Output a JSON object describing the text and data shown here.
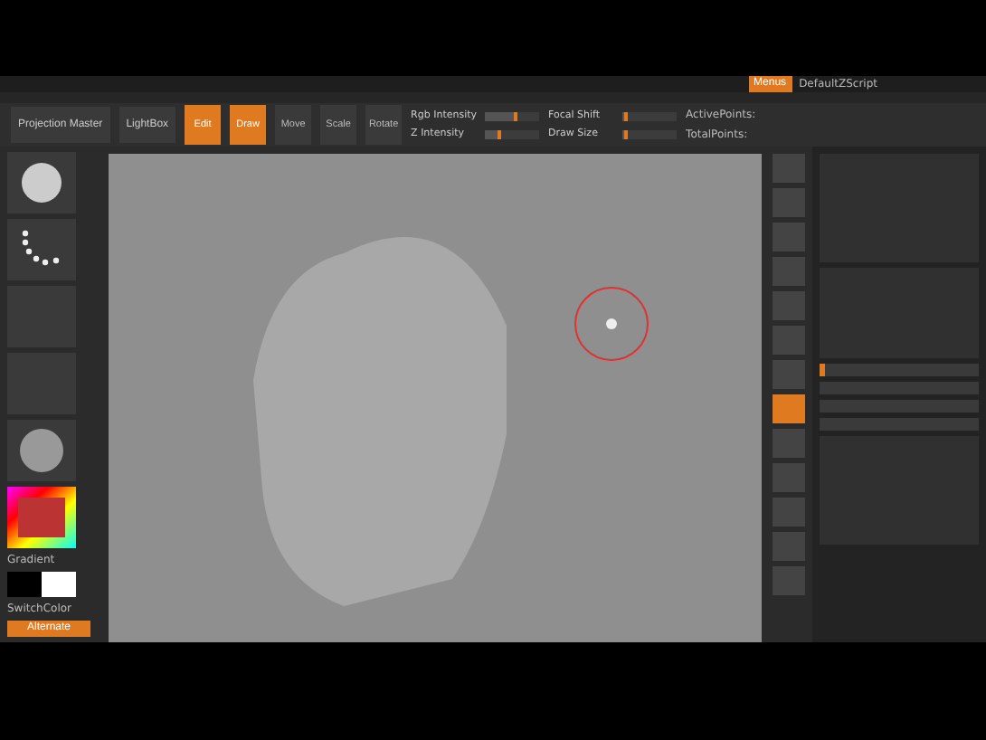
{
  "title_bar": {
    "menus_button": {
      "label": "Menus",
      "on": true
    },
    "script": "DefaultZScript"
  },
  "toolbar": {
    "left_buttons": [
      "Projection Master",
      "LightBox"
    ],
    "modes": [
      {
        "label": "Edit",
        "selected": true
      },
      {
        "label": "Draw",
        "selected": true
      },
      {
        "label": "Move",
        "selected": false
      },
      {
        "label": "Scale",
        "selected": false
      },
      {
        "label": "Rotate",
        "selected": false
      }
    ],
    "sliders": [
      {
        "label": "Rgb Intensity",
        "level": 0.6
      },
      {
        "label": "Z Intensity",
        "level": 0.3
      },
      {
        "label": "Focal Shift",
        "level": 0.1
      },
      {
        "label": "Draw Size",
        "level": 0.1
      }
    ],
    "readouts": [
      "ActivePoints:",
      "TotalPoints:"
    ]
  },
  "left_panel": {
    "color_label": "Gradient",
    "switch_label": "SwitchColor",
    "alternate": {
      "label": "Alternate",
      "on": true
    }
  },
  "right_shelf": [
    {
      "selected": false
    },
    {
      "selected": false
    },
    {
      "selected": false
    },
    {
      "selected": false
    },
    {
      "selected": false
    },
    {
      "selected": false
    },
    {
      "selected": false
    },
    {
      "selected": true
    },
    {
      "selected": false
    },
    {
      "selected": false
    },
    {
      "selected": false
    },
    {
      "selected": false
    },
    {
      "selected": false
    }
  ],
  "layers": [
    {
      "selected": true
    },
    {
      "selected": false
    },
    {
      "selected": false
    },
    {
      "selected": false
    }
  ]
}
